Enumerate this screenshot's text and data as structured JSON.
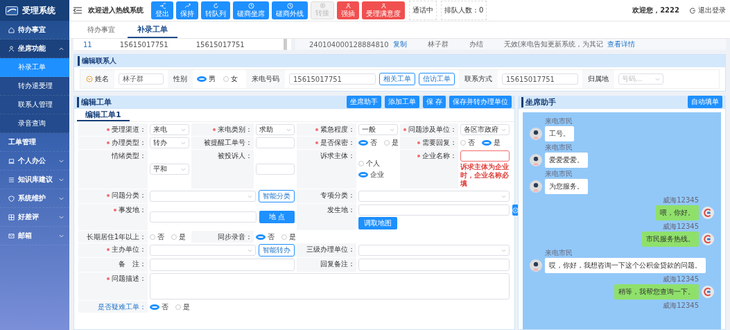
{
  "sidebar": {
    "logo_text": "受理系统",
    "items": [
      {
        "label": "待办事宜",
        "selected": false
      },
      {
        "label": "坐席功能",
        "selected": false,
        "expanded": true,
        "children": [
          {
            "label": "补录工单",
            "selected": true
          },
          {
            "label": "转办退受理",
            "selected": false
          },
          {
            "label": "联系人管理",
            "selected": false
          },
          {
            "label": "录音查询",
            "selected": false
          }
        ]
      },
      {
        "label": "工单管理",
        "selected": false
      },
      {
        "label": "个人办公",
        "selected": false,
        "expanded": false
      },
      {
        "label": "知识库建议",
        "selected": false,
        "expanded": false
      },
      {
        "label": "系统维护",
        "selected": false,
        "expanded": false
      },
      {
        "label": "好差评",
        "selected": false,
        "expanded": false
      },
      {
        "label": "邮箱",
        "selected": false,
        "expanded": false
      }
    ]
  },
  "topbar": {
    "welcome": "欢迎进入热线系统",
    "buttons": [
      {
        "label": "登出",
        "kind": "primary"
      },
      {
        "label": "保持",
        "kind": "primary"
      },
      {
        "label": "转队列",
        "kind": "primary"
      },
      {
        "label": "磋商坐席",
        "kind": "primary"
      },
      {
        "label": "磋商外线",
        "kind": "primary"
      },
      {
        "label": "转接",
        "kind": "disabled"
      },
      {
        "label": "强插",
        "kind": "danger"
      },
      {
        "label": "受理满意度",
        "kind": "danger"
      }
    ],
    "status": [
      "通话中",
      "排队人数：0"
    ],
    "greeting": "欢迎您，2222",
    "logout": "退出登录"
  },
  "tabs": [
    {
      "label": "待办事宜",
      "selected": false
    },
    {
      "label": "补录工单",
      "selected": true
    }
  ],
  "records": {
    "left_row": [
      "11",
      "15615017751",
      "15615017751"
    ],
    "right_row": [
      {
        "text": "240104000128884810",
        "kind": "text"
      },
      {
        "text": "复制",
        "kind": "link"
      },
      {
        "text": "林子群",
        "kind": "text"
      },
      {
        "text": "办结",
        "kind": "text"
      },
      {
        "text": "无效(来电告知更新系统，为其记",
        "kind": "text"
      },
      {
        "text": "查看详情",
        "kind": "link"
      }
    ]
  },
  "contact": {
    "title": "编辑联系人",
    "name_label": "姓名",
    "name_value": "林子群",
    "gender_label": "性别",
    "gender_options": [
      {
        "label": "男",
        "selected": true
      },
      {
        "label": "女",
        "selected": false
      }
    ],
    "phone_label": "来电号码",
    "phone_value": "15615017751",
    "buttons": [
      "相关工单",
      "信访工单"
    ],
    "contact_label": "联系方式",
    "contact_value": "15615017751",
    "region_label": "归属地",
    "region_placeholder": "号码..."
  },
  "edit": {
    "title": "编辑工单",
    "buttons": [
      "坐席助手",
      "添加工单",
      "保 存",
      "保存并转办理单位"
    ],
    "tabs": [
      {
        "label": "编辑工单1",
        "selected": true
      }
    ],
    "rows": [
      [
        {
          "kind": "select",
          "label": "受理渠道：",
          "required": true,
          "value": "来电"
        },
        {
          "kind": "select",
          "label": "来电类别：",
          "required": true,
          "value": "求助"
        },
        {
          "kind": "select",
          "label": "紧急程度：",
          "required": true,
          "value": "一般"
        },
        {
          "kind": "select",
          "label": "问题涉及单位：",
          "required": true,
          "value": "各区市政府"
        }
      ],
      [
        {
          "kind": "select",
          "label": "办理类型：",
          "required": true,
          "value": "转办"
        },
        {
          "kind": "input",
          "label": "被提醒工单号：",
          "required": false
        },
        {
          "kind": "radio",
          "label": "是否保密：",
          "required": true,
          "options": [
            {
              "label": "否",
              "selected": true
            },
            {
              "label": "是",
              "selected": false
            }
          ]
        },
        {
          "kind": "radio",
          "label": "需要回复：",
          "required": true,
          "options": [
            {
              "label": "否",
              "selected": false
            },
            {
              "label": "是",
              "selected": true
            }
          ]
        }
      ],
      [
        {
          "kind": "select",
          "label": "情绪类型：",
          "required": false,
          "value": "平和"
        },
        {
          "kind": "input",
          "label": "被投诉人：",
          "required": false
        },
        {
          "kind": "radio-vertical",
          "label": "诉求主体：",
          "required": false,
          "options": [
            {
              "label": "个人",
              "selected": false
            },
            {
              "label": "企业",
              "selected": true
            }
          ]
        },
        {
          "kind": "input",
          "label": "企业名称：",
          "required": true,
          "error": "诉求主体为企业时，企业名称必填"
        }
      ],
      [
        {
          "kind": "select-with-button",
          "label": "问题分类：",
          "required": true,
          "button": "智能分类"
        },
        {
          "kind": "select-wide",
          "label": "专项分类：",
          "required": false
        }
      ],
      [
        {
          "kind": "input-with-button",
          "label": "事发地：",
          "required": true,
          "button": "地 点"
        },
        {
          "kind": "location",
          "label": "发生地：",
          "required": false,
          "button": "调取地图"
        }
      ],
      [
        {
          "kind": "radio",
          "label": "长期居住1年以上：",
          "required": false,
          "options": [
            {
              "label": "否",
              "selected": false
            },
            {
              "label": "是",
              "selected": false
            }
          ]
        },
        {
          "kind": "radio",
          "label": "同步录音：",
          "required": false,
          "options": [
            {
              "label": "否",
              "selected": true
            },
            {
              "label": "是",
              "selected": false
            }
          ]
        }
      ],
      [
        {
          "kind": "select-with-button",
          "label": "主办单位：",
          "required": true,
          "button": "智能转办"
        },
        {
          "kind": "select-wide",
          "label": "三级办理单位：",
          "required": false
        }
      ],
      [
        {
          "kind": "textarea",
          "label": "备　注：",
          "required": false
        },
        {
          "kind": "textarea",
          "label": "回复备注：",
          "required": false
        }
      ],
      [
        {
          "kind": "textarea-full",
          "label": "问题描述：",
          "required": true
        }
      ],
      [
        {
          "kind": "highlight",
          "label": "是否疑难工单：",
          "required": false,
          "options": [
            {
              "label": "否",
              "selected": true
            },
            {
              "label": "是",
              "selected": false
            }
          ]
        }
      ]
    ]
  },
  "chat": {
    "title": "坐席助手",
    "button": "自动填单",
    "messages": [
      {
        "kind": "citizen",
        "sender": "来电市民",
        "text": "工号。"
      },
      {
        "kind": "citizen",
        "sender": "来电市民",
        "text": "爱爱爱爱。"
      },
      {
        "kind": "citizen",
        "sender": "来电市民",
        "text": "为您服务。"
      },
      {
        "kind": "agent",
        "sender": "威海12345",
        "text": "喂，你好。"
      },
      {
        "kind": "agent",
        "sender": "威海12345",
        "text": "市民服务热线。"
      },
      {
        "kind": "citizen",
        "sender": "来电市民",
        "text": "哎，你好，我想咨询一下这个公积金贷款的问题。"
      },
      {
        "kind": "agent",
        "sender": "威海12345",
        "text": "稍等，我帮您查询一下。"
      },
      {
        "kind": "agent",
        "sender": "威海12345"
      }
    ]
  }
}
